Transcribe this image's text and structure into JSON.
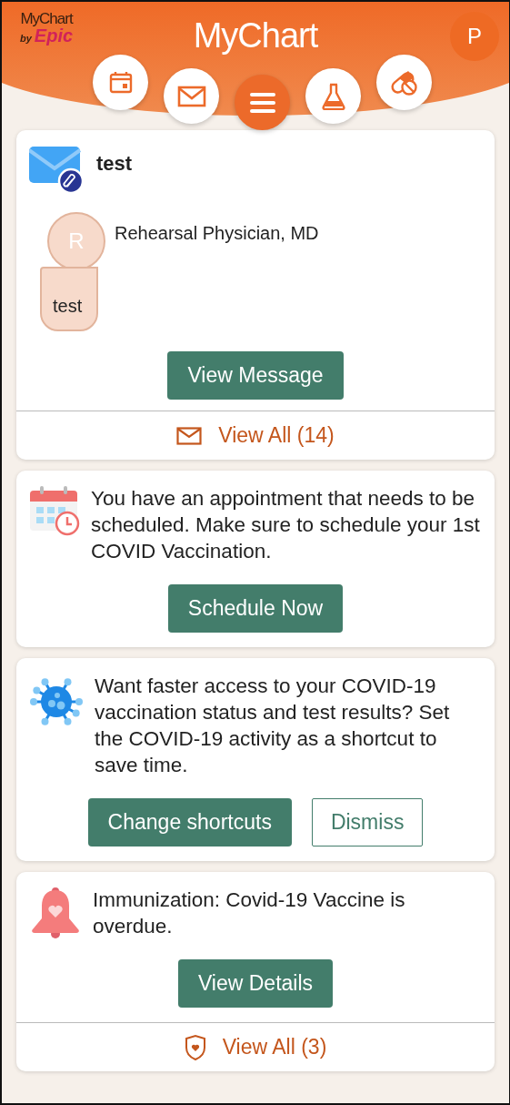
{
  "header": {
    "logo_top": "MyChart",
    "logo_by": "by",
    "logo_brand": "Epic",
    "title": "MyChart",
    "avatar_initial": "P"
  },
  "nav": [
    {
      "kind": "calendar"
    },
    {
      "kind": "messages"
    },
    {
      "kind": "menu"
    },
    {
      "kind": "lab"
    },
    {
      "kind": "pills"
    }
  ],
  "cards": [
    {
      "kind": "message",
      "title": "test",
      "sender_initial": "R",
      "sender": "Rehearsal Physician, MD",
      "preview": "test",
      "button": "View Message",
      "footer": {
        "label": "View All (14)"
      }
    },
    {
      "kind": "appointment",
      "text": "You have an appointment that needs to be scheduled. Make sure to schedule your 1st COVID Vaccination.",
      "button": "Schedule Now"
    },
    {
      "kind": "covid",
      "text": "Want faster access to your COVID-19 vaccination status and test results? Set the COVID-19 activity as a shortcut to save time.",
      "button": "Change shortcuts",
      "secondary_button": "Dismiss"
    },
    {
      "kind": "reminder",
      "text": "Immunization: Covid-19 Vaccine is overdue.",
      "button": "View Details",
      "footer": {
        "label": "View All (3)"
      }
    }
  ]
}
